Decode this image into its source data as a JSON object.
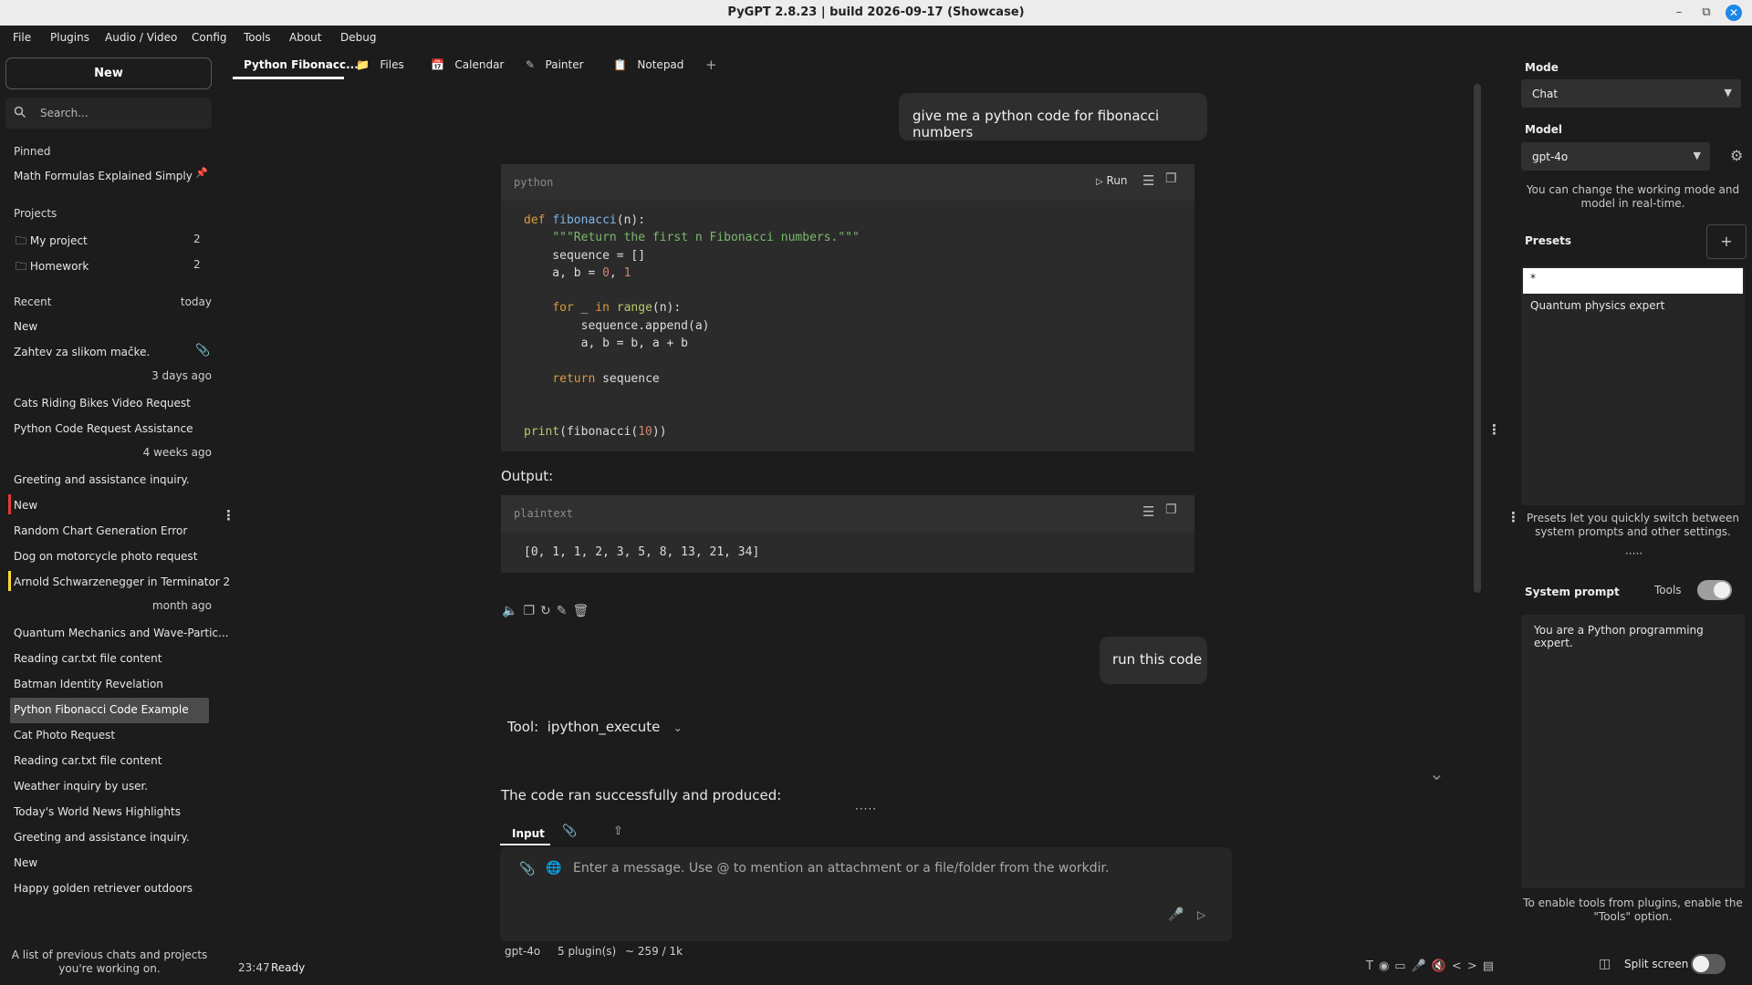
{
  "window": {
    "title": "PyGPT 2.8.23 | build 2026-09-17 (Showcase)"
  },
  "menu": [
    "File",
    "Plugins",
    "Audio / Video",
    "Config",
    "Tools",
    "About",
    "Debug"
  ],
  "sidebar": {
    "new_label": "New",
    "search_placeholder": "Search...",
    "pinned_header": "Pinned",
    "pinned": [
      "Math Formulas Explained Simply"
    ],
    "projects_header": "Projects",
    "projects": [
      {
        "name": "My project",
        "count": "2"
      },
      {
        "name": "Homework",
        "count": "2"
      }
    ],
    "recent_header": "Recent",
    "today_label": "today",
    "group_today": [
      "New",
      "Zahtev za slikom mačke."
    ],
    "days3_label": "3 days ago",
    "group_3days": [
      "Cats Riding Bikes Video Request",
      "Python Code Request Assistance"
    ],
    "weeks4_label": "4 weeks ago",
    "group_4weeks": [
      "Greeting and assistance inquiry.",
      "New",
      "Random Chart Generation Error",
      "Dog on motorcycle photo request",
      "Arnold Schwarzenegger in Terminator 2"
    ],
    "month_label": "month ago",
    "group_month": [
      "Quantum Mechanics and Wave-Partic...",
      "Reading car.txt file content",
      "Batman Identity Revelation",
      "Python Fibonacci Code Example",
      "Cat Photo Request",
      "Reading car.txt file content",
      "Weather inquiry by user.",
      "Today's World News Highlights",
      "Greeting and assistance inquiry.",
      "New",
      "Happy golden retriever outdoors"
    ],
    "footer": "A list of previous chats and projects you're working on.",
    "colors": {
      "red_mark": "#e53935",
      "yellow_mark": "#fdd835"
    }
  },
  "tabs": [
    {
      "label": "Python Fibonacc...",
      "icon": ""
    },
    {
      "label": "Files",
      "icon": "folder-icon"
    },
    {
      "label": "Calendar",
      "icon": "calendar-icon"
    },
    {
      "label": "Painter",
      "icon": "brush-icon"
    },
    {
      "label": "Notepad",
      "icon": "notepad-icon"
    }
  ],
  "chat": {
    "user_msg_1": "give me a python code for fibonacci numbers",
    "code_lang": "python",
    "run_label": "Run",
    "output_label": "Output:",
    "output_lang": "plaintext",
    "output_text": "[0, 1, 1, 2, 3, 5, 8, 13, 21, 34]",
    "user_msg_2": "run this code",
    "tool_label": "Tool:",
    "tool_name": "ipython_execute",
    "result_text": "The code ran successfully and produced:"
  },
  "input": {
    "tab_input": "Input",
    "placeholder": "Enter a message. Use @ to mention an attachment or a file/folder from the workdir.",
    "model_status": "gpt-4o",
    "plugins_status": "5 plugin(s)",
    "tokens_status": "~ 259 / 1k"
  },
  "statusbar": {
    "time": "23:47",
    "state": "Ready"
  },
  "right": {
    "mode_label": "Mode",
    "mode_value": "Chat",
    "model_label": "Model",
    "model_value": "gpt-4o",
    "model_note": "You can change the working mode and model in real-time.",
    "presets_label": "Presets",
    "presets": [
      "*",
      "Quantum physics expert"
    ],
    "presets_note": "Presets let you quickly switch between system prompts and other settings.",
    "system_prompt_label": "System prompt",
    "tools_label": "Tools",
    "system_prompt_text": "You are a Python programming expert.",
    "tools_note": "To enable tools from plugins, enable the \"Tools\" option.",
    "split_label": "Split screen",
    "toggles": {
      "tools_on": true,
      "split_on": false
    },
    "colors": {
      "toggle_on": "#9e9e9e",
      "toggle_off": "#5a5a5a"
    }
  }
}
